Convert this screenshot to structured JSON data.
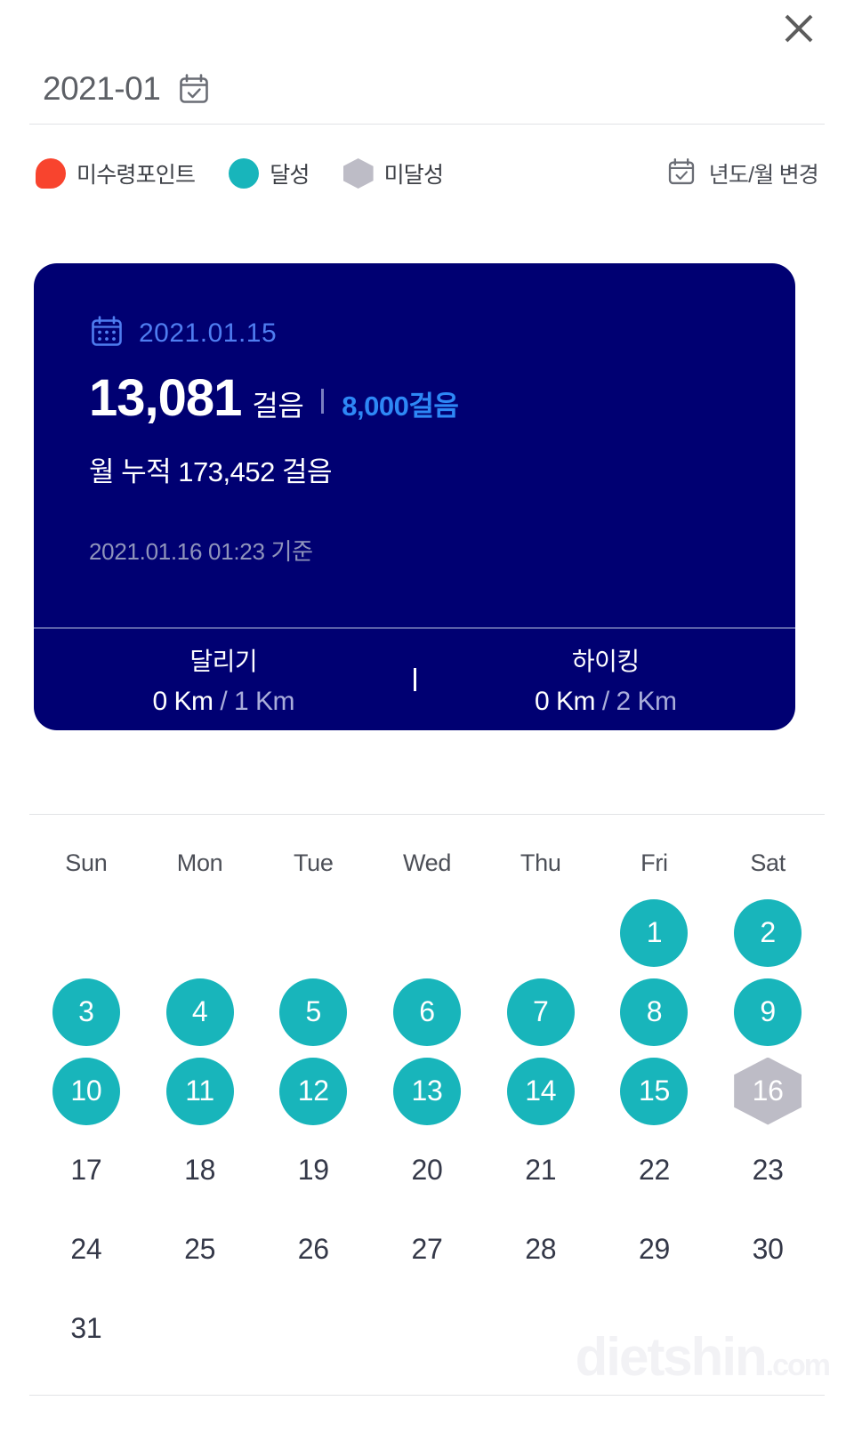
{
  "header": {
    "close_icon": "close-icon",
    "month_label": "2021-01",
    "month_calendar_icon": "calendar-check-icon"
  },
  "legend": {
    "items": [
      {
        "marker": "drop",
        "color": "#f8442e",
        "label": "미수령포인트"
      },
      {
        "marker": "circle",
        "color": "#18b5bb",
        "label": "달성"
      },
      {
        "marker": "hex",
        "color": "#bdbcc6",
        "label": "미달성"
      }
    ],
    "change_button": {
      "icon": "calendar-check-icon",
      "label": "년도/월 변경"
    }
  },
  "card": {
    "background_color": "#000072",
    "date_icon": "calendar-dots-icon",
    "date": "2021.01.15",
    "steps_value": "13,081",
    "steps_unit": "걸음",
    "steps_goal": "8,000걸음",
    "month_total": "월 누적 173,452 걸음",
    "basis": "2021.01.16 01:23 기준",
    "stats": [
      {
        "title": "달리기",
        "value": "0 Km",
        "goal": "/ 1 Km"
      },
      {
        "title": "하이킹",
        "value": "0 Km",
        "goal": "/ 2 Km"
      }
    ]
  },
  "calendar": {
    "weekday_headers": [
      "Sun",
      "Mon",
      "Tue",
      "Wed",
      "Thu",
      "Fri",
      "Sat"
    ],
    "weeks": [
      [
        {
          "day": "",
          "state": "empty"
        },
        {
          "day": "",
          "state": "empty"
        },
        {
          "day": "",
          "state": "empty"
        },
        {
          "day": "",
          "state": "empty"
        },
        {
          "day": "",
          "state": "empty"
        },
        {
          "day": "1",
          "state": "achieved"
        },
        {
          "day": "2",
          "state": "achieved"
        }
      ],
      [
        {
          "day": "3",
          "state": "achieved"
        },
        {
          "day": "4",
          "state": "achieved"
        },
        {
          "day": "5",
          "state": "achieved"
        },
        {
          "day": "6",
          "state": "achieved"
        },
        {
          "day": "7",
          "state": "achieved"
        },
        {
          "day": "8",
          "state": "achieved"
        },
        {
          "day": "9",
          "state": "achieved"
        }
      ],
      [
        {
          "day": "10",
          "state": "achieved"
        },
        {
          "day": "11",
          "state": "achieved"
        },
        {
          "day": "12",
          "state": "achieved"
        },
        {
          "day": "13",
          "state": "achieved"
        },
        {
          "day": "14",
          "state": "achieved"
        },
        {
          "day": "15",
          "state": "achieved"
        },
        {
          "day": "16",
          "state": "missed"
        }
      ],
      [
        {
          "day": "17",
          "state": "plain"
        },
        {
          "day": "18",
          "state": "plain"
        },
        {
          "day": "19",
          "state": "plain"
        },
        {
          "day": "20",
          "state": "plain"
        },
        {
          "day": "21",
          "state": "plain"
        },
        {
          "day": "22",
          "state": "plain"
        },
        {
          "day": "23",
          "state": "plain"
        }
      ],
      [
        {
          "day": "24",
          "state": "plain"
        },
        {
          "day": "25",
          "state": "plain"
        },
        {
          "day": "26",
          "state": "plain"
        },
        {
          "day": "27",
          "state": "plain"
        },
        {
          "day": "28",
          "state": "plain"
        },
        {
          "day": "29",
          "state": "plain"
        },
        {
          "day": "30",
          "state": "plain"
        }
      ],
      [
        {
          "day": "31",
          "state": "plain"
        },
        {
          "day": "",
          "state": "empty"
        },
        {
          "day": "",
          "state": "empty"
        },
        {
          "day": "",
          "state": "empty"
        },
        {
          "day": "",
          "state": "empty"
        },
        {
          "day": "",
          "state": "empty"
        },
        {
          "day": "",
          "state": "empty"
        }
      ]
    ]
  },
  "watermark": {
    "name": "dietshin",
    "domain": ".com"
  }
}
